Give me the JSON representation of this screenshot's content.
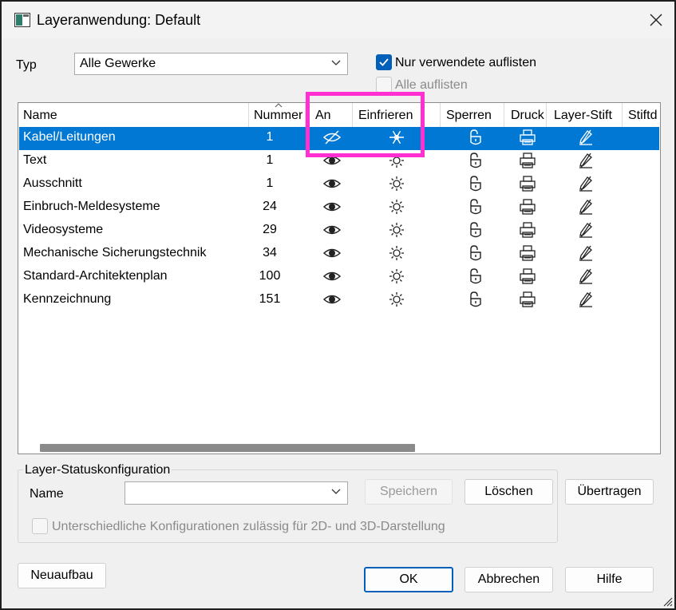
{
  "window": {
    "title": "Layeranwendung: Default"
  },
  "filter": {
    "type_label": "Typ",
    "type_value": "Alle Gewerke",
    "only_used_label": "Nur verwendete auflisten",
    "only_used_checked": true,
    "all_label": "Alle auflisten",
    "all_checked": false
  },
  "table": {
    "columns": [
      "Name",
      "Nummer",
      "An",
      "Einfrieren",
      "Sperren",
      "Druck",
      "Layer-Stift",
      "Stiftd"
    ],
    "rows": [
      {
        "name": "Kabel/Leitungen",
        "number": "1",
        "selected": true,
        "visible": false,
        "frozen": true
      },
      {
        "name": "Text",
        "number": "1",
        "selected": false,
        "visible": true,
        "frozen": false
      },
      {
        "name": "Ausschnitt",
        "number": "1",
        "selected": false,
        "visible": true,
        "frozen": false
      },
      {
        "name": "Einbruch-Meldesysteme",
        "number": "24",
        "selected": false,
        "visible": true,
        "frozen": false
      },
      {
        "name": "Videosysteme",
        "number": "29",
        "selected": false,
        "visible": true,
        "frozen": false
      },
      {
        "name": "Mechanische Sicherungstechnik",
        "number": "34",
        "selected": false,
        "visible": true,
        "frozen": false
      },
      {
        "name": "Standard-Architektenplan",
        "number": "100",
        "selected": false,
        "visible": true,
        "frozen": false
      },
      {
        "name": "Kennzeichnung",
        "number": "151",
        "selected": false,
        "visible": true,
        "frozen": false
      }
    ]
  },
  "status_config": {
    "group_title": "Layer-Statuskonfiguration",
    "name_label": "Name",
    "name_value": "",
    "save_label": "Speichern",
    "delete_label": "Löschen",
    "transfer_label": "Übertragen",
    "different_configs_label": "Unterschiedliche Konfigurationen zulässig für 2D- und 3D-Darstellung"
  },
  "footer": {
    "rebuild_label": "Neuaufbau",
    "ok_label": "OK",
    "cancel_label": "Abbrechen",
    "help_label": "Hilfe"
  },
  "colors": {
    "selection": "#0078d4",
    "checkbox_accent": "#005fb8",
    "annotation_highlight": "#ff2fd2"
  },
  "icons": {
    "visible": "eye-icon",
    "hidden": "eye-off-icon",
    "thawed": "sun-icon",
    "frozen": "snowflake-icon",
    "lock": "unlocked-lock-icon",
    "print": "printer-icon",
    "pen": "pen-icon"
  }
}
